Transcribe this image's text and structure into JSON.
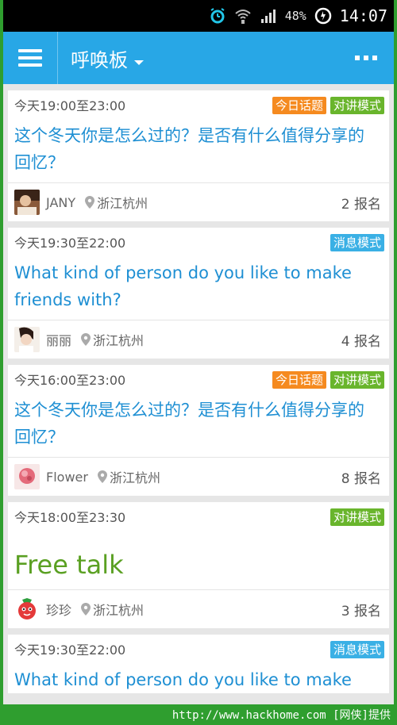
{
  "status_bar": {
    "battery": "48%",
    "time": "14:07",
    "icons": [
      "alarm-icon",
      "wifi-icon",
      "signal-icon",
      "battery-icon"
    ]
  },
  "app_bar": {
    "title": "呼唤板",
    "menu_icon": "hamburger-icon",
    "more_icon": "more-icon",
    "color": "#28a7e6"
  },
  "cards": [
    {
      "time": "今天19:00至23:00",
      "tags": [
        {
          "label": "今日话题",
          "color": "orange"
        },
        {
          "label": "对讲模式",
          "color": "green"
        }
      ],
      "title": "这个冬天你是怎么过的？是否有什么值得分享的回忆？",
      "user": "JANY",
      "location": "浙江杭州",
      "count": "2 报名"
    },
    {
      "time": "今天19:30至22:00",
      "tags": [
        {
          "label": "消息模式",
          "color": "blue"
        }
      ],
      "title": "What kind of person do you like to make friends with?",
      "user": "丽丽",
      "location": "浙江杭州",
      "count": "4 报名"
    },
    {
      "time": "今天16:00至23:00",
      "tags": [
        {
          "label": "今日话题",
          "color": "orange"
        },
        {
          "label": "对讲模式",
          "color": "green"
        }
      ],
      "title": "这个冬天你是怎么过的？是否有什么值得分享的回忆？",
      "user": "Flower",
      "location": "浙江杭州",
      "count": "8 报名"
    },
    {
      "time": "今天18:00至23:30",
      "tags": [
        {
          "label": "对讲模式",
          "color": "green"
        }
      ],
      "title": "Free talk",
      "user": "珍珍",
      "location": "浙江杭州",
      "count": "3 报名"
    },
    {
      "time": "今天19:30至22:00",
      "tags": [
        {
          "label": "消息模式",
          "color": "blue"
        }
      ],
      "title": "What kind of person do you like to make"
    }
  ],
  "watermark": "http://www.hackhome.com [网侠]提供",
  "colors": {
    "tag_orange": "#f58a1f",
    "tag_green": "#69b52c",
    "tag_blue": "#3ab0e5",
    "title_blue": "#1e8fd3",
    "title_green": "#5aa022"
  }
}
